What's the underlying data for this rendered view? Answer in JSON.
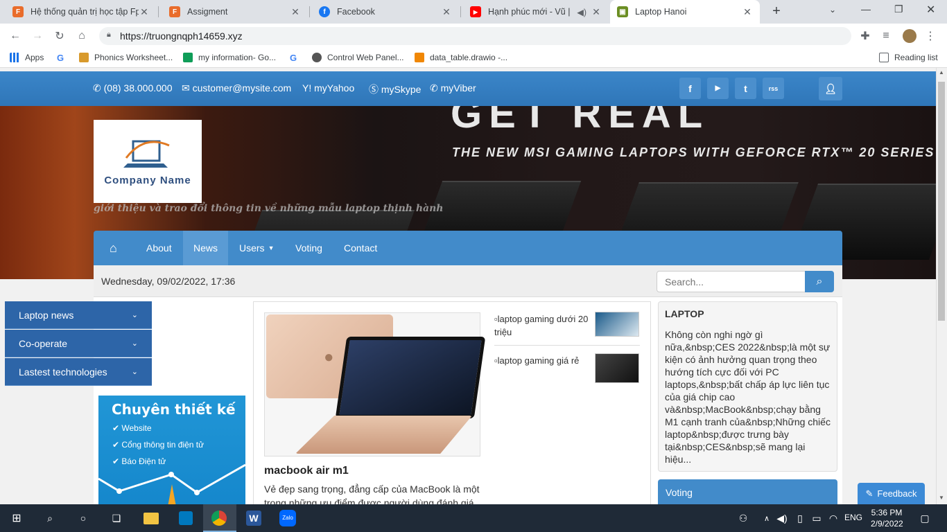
{
  "browser": {
    "tabs": [
      {
        "title": "Hệ thống quản trị học tập Fp",
        "icon": "fpt-icon",
        "color": "#e96c2b"
      },
      {
        "title": "Assigment",
        "icon": "fpt-icon",
        "color": "#e96c2b"
      },
      {
        "title": "Facebook",
        "icon": "facebook-icon",
        "color": "#1877f2"
      },
      {
        "title": "Hạnh phúc mới - Vũ | Lyr",
        "icon": "youtube-icon",
        "color": "#ff0000"
      },
      {
        "title": "Laptop Hanoi",
        "icon": "site-icon",
        "color": "#6b8e23"
      }
    ],
    "url": "https://truongnqph14659.xyz",
    "bookmarks": [
      {
        "label": "Apps",
        "icon": "apps-grid-icon"
      },
      {
        "label": "",
        "icon": "google-icon"
      },
      {
        "label": "Phonics Worksheet...",
        "icon": "bookmark-icon"
      },
      {
        "label": "my information- Go...",
        "icon": "sheets-icon"
      },
      {
        "label": "",
        "icon": "google-icon"
      },
      {
        "label": "Control Web Panel...",
        "icon": "cwp-icon"
      },
      {
        "label": "data_table.drawio -...",
        "icon": "drawio-icon"
      }
    ],
    "reading_list": "Reading list"
  },
  "topbar": {
    "phone": "(08) 38.000.000",
    "email": "customer@mysite.com",
    "yahoo": "myYahoo",
    "skype": "mySkype",
    "viber": "myViber",
    "socials": [
      "f",
      "▶",
      "t",
      "rss"
    ]
  },
  "banner": {
    "headline": "GET REAL",
    "subheadline": "THE NEW MSI GAMING LAPTOPS WITH GEFORCE RTX™ 20 SERIES",
    "logo_text": "Company Name",
    "tagline": "giới thiệu và trao đổi thông tin về những mẫu laptop thịnh hành"
  },
  "nav": {
    "items": [
      "About",
      "News",
      "Users",
      "Voting",
      "Contact"
    ],
    "active": "News"
  },
  "datebar": {
    "date": "Wednesday, 09/02/2022, 17:36",
    "search_placeholder": "Search..."
  },
  "sidebar": {
    "items": [
      "Laptop news",
      "Co-operate",
      "Lastest technologies"
    ],
    "ad_title": "Chuyên thiết kế",
    "ad_items": [
      "Website",
      "Cổng thông tin điện tử",
      "Báo Điện tử"
    ]
  },
  "main": {
    "feature_title": "macbook air m1",
    "feature_excerpt_1": "Vẻ đẹp sang trọng, đẳng cấp của MacBook là một",
    "feature_excerpt_2": "trong những ưu điểm được người dùng đánh giá",
    "side_articles": [
      "laptop gaming dưới 20 triệu",
      "laptop gaming giá rẻ"
    ]
  },
  "right": {
    "heading": "LAPTOP",
    "body": "Không còn nghi ngờ gì nữa,&nbsp;CES 2022&nbsp;là một sự kiện có ảnh hưởng quan trọng theo hướng tích cực đối với PC laptops,&nbsp;bất chấp áp lực liên tục của giá chip cao và&nbsp;MacBook&nbsp;chạy bằng M1 cạnh tranh của&nbsp;Những chiếc laptop&nbsp;được trưng bày tại&nbsp;CES&nbsp;sẽ mang lại hiệu...",
    "voting": "Voting",
    "feedback": "Feedback"
  },
  "taskbar": {
    "lang": "ENG",
    "time": "5:36 PM",
    "date": "2/9/2022"
  }
}
